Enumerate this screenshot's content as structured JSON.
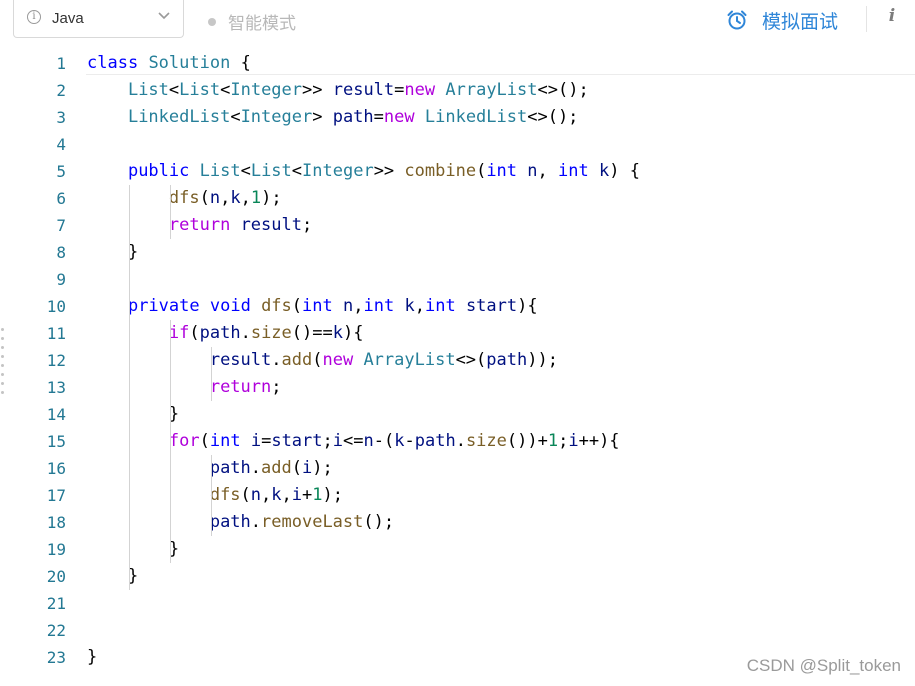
{
  "toolbar": {
    "language": "Java",
    "smart_mode_label": "智能模式",
    "mock_interview_label": "模拟面试",
    "info_glyph": "i",
    "lang_info_glyph": "i"
  },
  "icons": {
    "language_info": "info-circle-icon",
    "dropdown": "chevron-down-icon",
    "smart_mode": "dot-icon",
    "mock_interview": "alarm-clock-icon",
    "info": "info-icon"
  },
  "colors": {
    "accent": "#2f86d8",
    "keyword": "#0000ff",
    "class": "#267f99",
    "function": "#795e26",
    "variable": "#001080",
    "control": "#af00db",
    "number": "#098658",
    "line_number": "#237893"
  },
  "editor": {
    "line_numbers": [
      "1",
      "2",
      "3",
      "4",
      "5",
      "6",
      "7",
      "8",
      "9",
      "10",
      "11",
      "12",
      "13",
      "14",
      "15",
      "16",
      "17",
      "18",
      "19",
      "20",
      "21",
      "22",
      "23"
    ],
    "lines": [
      [
        [
          "kw",
          "class"
        ],
        [
          "txt",
          " "
        ],
        [
          "cls",
          "Solution"
        ],
        [
          "txt",
          " {"
        ]
      ],
      [
        [
          "txt",
          "    "
        ],
        [
          "cls",
          "List"
        ],
        [
          "txt",
          "<"
        ],
        [
          "cls",
          "List"
        ],
        [
          "txt",
          "<"
        ],
        [
          "cls",
          "Integer"
        ],
        [
          "txt",
          ">> "
        ],
        [
          "var",
          "result"
        ],
        [
          "txt",
          "="
        ],
        [
          "ctl",
          "new"
        ],
        [
          "txt",
          " "
        ],
        [
          "cls",
          "ArrayList"
        ],
        [
          "txt",
          "<>();"
        ]
      ],
      [
        [
          "txt",
          "    "
        ],
        [
          "cls",
          "LinkedList"
        ],
        [
          "txt",
          "<"
        ],
        [
          "cls",
          "Integer"
        ],
        [
          "txt",
          "> "
        ],
        [
          "var",
          "path"
        ],
        [
          "txt",
          "="
        ],
        [
          "ctl",
          "new"
        ],
        [
          "txt",
          " "
        ],
        [
          "cls",
          "LinkedList"
        ],
        [
          "txt",
          "<>();"
        ]
      ],
      [],
      [
        [
          "txt",
          "    "
        ],
        [
          "kw",
          "public"
        ],
        [
          "txt",
          " "
        ],
        [
          "cls",
          "List"
        ],
        [
          "txt",
          "<"
        ],
        [
          "cls",
          "List"
        ],
        [
          "txt",
          "<"
        ],
        [
          "cls",
          "Integer"
        ],
        [
          "txt",
          ">> "
        ],
        [
          "fn",
          "combine"
        ],
        [
          "txt",
          "("
        ],
        [
          "kw",
          "int"
        ],
        [
          "txt",
          " "
        ],
        [
          "var",
          "n"
        ],
        [
          "txt",
          ", "
        ],
        [
          "kw",
          "int"
        ],
        [
          "txt",
          " "
        ],
        [
          "var",
          "k"
        ],
        [
          "txt",
          ") {"
        ]
      ],
      [
        [
          "txt",
          "        "
        ],
        [
          "fn",
          "dfs"
        ],
        [
          "txt",
          "("
        ],
        [
          "var",
          "n"
        ],
        [
          "txt",
          ","
        ],
        [
          "var",
          "k"
        ],
        [
          "txt",
          ","
        ],
        [
          "num",
          "1"
        ],
        [
          "txt",
          ");"
        ]
      ],
      [
        [
          "txt",
          "        "
        ],
        [
          "ctl",
          "return"
        ],
        [
          "txt",
          " "
        ],
        [
          "var",
          "result"
        ],
        [
          "txt",
          ";"
        ]
      ],
      [
        [
          "txt",
          "    }"
        ]
      ],
      [],
      [
        [
          "txt",
          "    "
        ],
        [
          "kw",
          "private"
        ],
        [
          "txt",
          " "
        ],
        [
          "kw",
          "void"
        ],
        [
          "txt",
          " "
        ],
        [
          "fn",
          "dfs"
        ],
        [
          "txt",
          "("
        ],
        [
          "kw",
          "int"
        ],
        [
          "txt",
          " "
        ],
        [
          "var",
          "n"
        ],
        [
          "txt",
          ","
        ],
        [
          "kw",
          "int"
        ],
        [
          "txt",
          " "
        ],
        [
          "var",
          "k"
        ],
        [
          "txt",
          ","
        ],
        [
          "kw",
          "int"
        ],
        [
          "txt",
          " "
        ],
        [
          "var",
          "start"
        ],
        [
          "txt",
          "){"
        ]
      ],
      [
        [
          "txt",
          "        "
        ],
        [
          "ctl",
          "if"
        ],
        [
          "txt",
          "("
        ],
        [
          "var",
          "path"
        ],
        [
          "txt",
          "."
        ],
        [
          "fn",
          "size"
        ],
        [
          "txt",
          "()=="
        ],
        [
          "var",
          "k"
        ],
        [
          "txt",
          "){"
        ]
      ],
      [
        [
          "txt",
          "            "
        ],
        [
          "var",
          "result"
        ],
        [
          "txt",
          "."
        ],
        [
          "fn",
          "add"
        ],
        [
          "txt",
          "("
        ],
        [
          "ctl",
          "new"
        ],
        [
          "txt",
          " "
        ],
        [
          "cls",
          "ArrayList"
        ],
        [
          "txt",
          "<>("
        ],
        [
          "var",
          "path"
        ],
        [
          "txt",
          "));"
        ]
      ],
      [
        [
          "txt",
          "            "
        ],
        [
          "ctl",
          "return"
        ],
        [
          "txt",
          ";"
        ]
      ],
      [
        [
          "txt",
          "        }"
        ]
      ],
      [
        [
          "txt",
          "        "
        ],
        [
          "ctl",
          "for"
        ],
        [
          "txt",
          "("
        ],
        [
          "kw",
          "int"
        ],
        [
          "txt",
          " "
        ],
        [
          "var",
          "i"
        ],
        [
          "txt",
          "="
        ],
        [
          "var",
          "start"
        ],
        [
          "txt",
          ";"
        ],
        [
          "var",
          "i"
        ],
        [
          "txt",
          "<="
        ],
        [
          "var",
          "n"
        ],
        [
          "txt",
          "-("
        ],
        [
          "var",
          "k"
        ],
        [
          "txt",
          "-"
        ],
        [
          "var",
          "path"
        ],
        [
          "txt",
          "."
        ],
        [
          "fn",
          "size"
        ],
        [
          "txt",
          "())+"
        ],
        [
          "num",
          "1"
        ],
        [
          "txt",
          ";"
        ],
        [
          "var",
          "i"
        ],
        [
          "txt",
          "++){"
        ]
      ],
      [
        [
          "txt",
          "            "
        ],
        [
          "var",
          "path"
        ],
        [
          "txt",
          "."
        ],
        [
          "fn",
          "add"
        ],
        [
          "txt",
          "("
        ],
        [
          "var",
          "i"
        ],
        [
          "txt",
          ");"
        ]
      ],
      [
        [
          "txt",
          "            "
        ],
        [
          "fn",
          "dfs"
        ],
        [
          "txt",
          "("
        ],
        [
          "var",
          "n"
        ],
        [
          "txt",
          ","
        ],
        [
          "var",
          "k"
        ],
        [
          "txt",
          ","
        ],
        [
          "var",
          "i"
        ],
        [
          "txt",
          "+"
        ],
        [
          "num",
          "1"
        ],
        [
          "txt",
          ");"
        ]
      ],
      [
        [
          "txt",
          "            "
        ],
        [
          "var",
          "path"
        ],
        [
          "txt",
          "."
        ],
        [
          "fn",
          "removeLast"
        ],
        [
          "txt",
          "();"
        ]
      ],
      [
        [
          "txt",
          "        }"
        ]
      ],
      [
        [
          "txt",
          "    }"
        ]
      ],
      [],
      [],
      [
        [
          "txt",
          "}"
        ]
      ]
    ]
  },
  "watermark": "CSDN @Split_token"
}
